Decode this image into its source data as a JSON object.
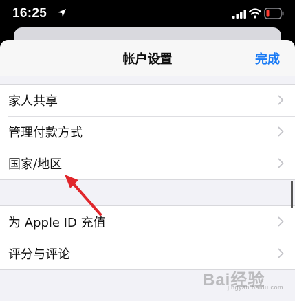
{
  "status_bar": {
    "time": "16:25",
    "icons": [
      "location-arrow-icon",
      "cellular-signal-icon",
      "wifi-icon",
      "battery-low-icon"
    ],
    "battery_color": "#ff3b30"
  },
  "nav": {
    "title": "帐户设置",
    "done_label": "完成",
    "accent_color": "#1a7bf5"
  },
  "groups": [
    {
      "rows": [
        {
          "label": "家人共享"
        },
        {
          "label": "管理付款方式"
        },
        {
          "label": "国家/地区"
        }
      ]
    },
    {
      "rows": [
        {
          "label": "为 Apple ID 充值"
        },
        {
          "label": "评分与评论"
        }
      ]
    }
  ],
  "annotation": {
    "arrow_color": "#e0262b"
  },
  "watermark": {
    "text": "Bai经验",
    "subtext": "jingyan.baidu.com"
  }
}
